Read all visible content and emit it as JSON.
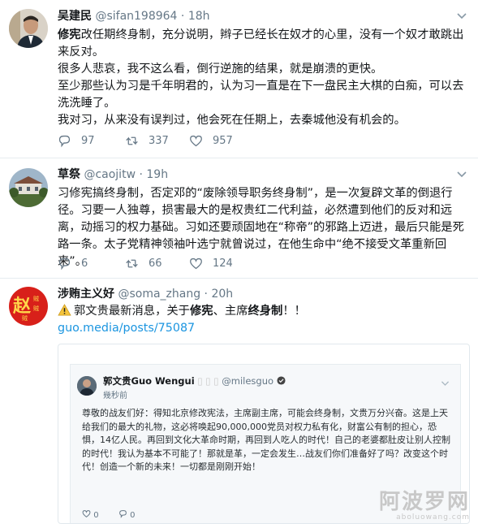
{
  "tweets": [
    {
      "name": "吴建民",
      "handle": "@sifan198964",
      "dot": "·",
      "time": "18h",
      "paragraphs": [
        {
          "bold": "修宪",
          "text": "改任期终身制，充分说明，辫子已经长在奴才的心里，没有一个奴才敢跳出来反对。"
        },
        {
          "bold": "",
          "text": "很多人悲哀，我不这么看，倒行逆施的结果，就是崩溃的更快。"
        },
        {
          "bold": "",
          "text": "至少那些认为习是千年明君的，认为习一直是在下一盘民主大棋的白痴，可以去洗洗睡了。"
        },
        {
          "bold": "",
          "text": "我对习，从来没有误判过，他会死在任期上，去秦城他没有机会的。"
        }
      ],
      "replies": "97",
      "retweets": "337",
      "likes": "957"
    },
    {
      "name": "草祭",
      "handle": "@caojitw",
      "dot": "·",
      "time": "19h",
      "text": "习修宪搞终身制，否定邓的“废除领导职务终身制”，是一次复辟文革的倒退行径。习要一人独尊，损害最大的是权贵红二代利益，必然遭到他们的反对和远离，动摇习的权力基础。习如还要顽固地在“称帝”的邪路上迈进，最后只能是死路一条。太子党精神领袖叶选宁就曾说过，在他生命中“绝不接受文革重新回来”。",
      "replies": "6",
      "retweets": "66",
      "likes": "124"
    },
    {
      "name": "涉贿主义好",
      "handle": "@soma_zhang",
      "dot": "·",
      "time": "20h",
      "avatar_char": "赵",
      "avatar_small": "贼",
      "line1_pre": "郭文贵最新消息，关于",
      "line1_bold1": "修宪",
      "line1_mid": "、主席",
      "line1_bold2": "终身制",
      "line1_post": "！！",
      "link": "guo.media/posts/75087"
    }
  ],
  "embed": {
    "name": "郭文贵Guo Wengui",
    "handle": "@milesguo",
    "time": "幾秒前",
    "text": "尊敬的战友们好：得知北京修改宪法，主席副主席，可能会终身制，文贵万分兴奋。这是上天给我们的最大的礼物，这必将唤起90,000,000党员对权力私有化，财富公有制的担心，恐惧，14亿人民。再回到文化大革命时期，再回到人吃人的时代！自己的老婆都肚皮让别人控制的时代！我认为基本不可能了！那就是革，一定会发生…战友们你们准备好了吗？改变这个时代！创造一个新的未来！一切都是刚刚开始！",
    "likes": "0",
    "comments": "0"
  },
  "watermark": {
    "cn": "阿波罗网",
    "en": "aboluowang.com"
  },
  "colors": {
    "accent": "#1b95e0",
    "muted": "#657786",
    "border": "#e6ecf0",
    "avatar_red": "#d8201a"
  }
}
